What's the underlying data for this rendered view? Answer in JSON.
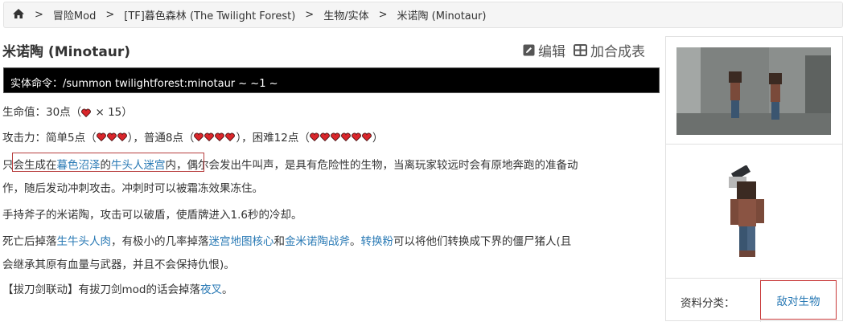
{
  "breadcrumb": {
    "items": [
      "冒险Mod",
      "[TF]暮色森林 (The Twilight Forest)",
      "生物/实体",
      "米诺陶 (Minotaur)"
    ],
    "separator": ">"
  },
  "page": {
    "title": "米诺陶 (Minotaur)",
    "edit_label": "编辑",
    "add_label": "加合成表"
  },
  "command": {
    "text": "实体命令：/summon twilightforest:minotaur ~ ~1 ~"
  },
  "stats": {
    "health_prefix": "生命值：30点（",
    "health_suffix": " × 15）",
    "attack_prefix": "攻击力：简单5点（",
    "attack_normal": "），普通8点（",
    "attack_hard": "），困难12点（",
    "attack_end": "）",
    "easy_hearts": 3,
    "normal_hearts": 4,
    "hard_hearts": 6
  },
  "paragraphs": {
    "p1_a": "只会生成在",
    "p1_link1": "暮色沼泽",
    "p1_b": "的",
    "p1_link2": "牛头人迷宫",
    "p1_c": "内，偶尔会发出牛叫声，是具有危险性的生物，当离玩家较远时会有原地奔跑的准备动",
    "p1_line2": "作，随后发动冲刺攻击。冲刺时可以被霜冻效果冻住。",
    "p2": "手持斧子的米诺陶，攻击可以破盾，使盾牌进入1.6秒的冷却。",
    "p3_a": "死亡后掉落",
    "p3_link1": "生牛头人肉",
    "p3_b": "，有极小的几率掉落",
    "p3_link2": "迷宫地图核心",
    "p3_c": "和",
    "p3_link3": "金米诺陶战斧",
    "p3_d": "。",
    "p3_link4": "转换粉",
    "p3_e": "可以将他们转换成下界的僵尸猪人(且",
    "p3_line2": "会继承其原有血量与武器，并且不会保持仇恨)。",
    "p4_a": "【拔刀剑联动】有拔刀剑mod的话会掉落",
    "p4_link": "夜叉",
    "p4_b": "。"
  },
  "sidebar": {
    "category_label": "资料分类：",
    "category_value": "敌对生物"
  },
  "colors": {
    "link": "#2a7ab5",
    "highlight_border": "#b73d3d",
    "heart": "#d9262b"
  }
}
